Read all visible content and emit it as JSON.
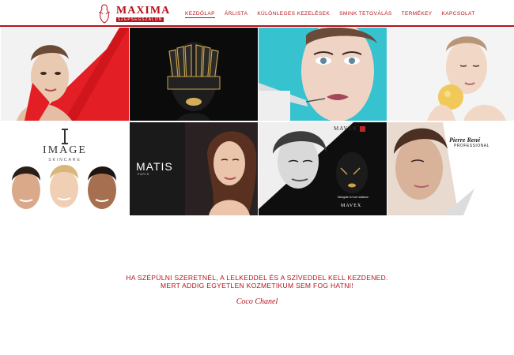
{
  "brand": {
    "name": "MAXIMA",
    "subtitle": "SZÉPSÉGSZALON",
    "accent": "#b5121b"
  },
  "nav": {
    "items": [
      {
        "label": "KEZDŐLAP",
        "active": true
      },
      {
        "label": "ÁRLISTA"
      },
      {
        "label": "KÜLÖNLEGES KEZELÉSEK"
      },
      {
        "label": "SMINK TETOVÁLÁS"
      },
      {
        "label": "TERMÉKEY"
      },
      {
        "label": "KAPCSOLAT"
      }
    ]
  },
  "gallery": {
    "brands": {
      "image": {
        "name": "IMAGE",
        "sub": "SKINCARE"
      },
      "matis": {
        "name": "MATIS",
        "sub": "PARIS"
      },
      "mavex": {
        "name": "MAVEX",
        "tagline": "Navigate to true radiance",
        "name2": "MAVEX"
      },
      "pierre": {
        "name": "Pierre René",
        "sub": "PROFESSIONAL"
      }
    }
  },
  "quote": {
    "line1": "HA SZÉPÜLNI SZERETNÉL, A LELKEDDEL ÉS A SZÍVEDDEL KELL KEZDENED.",
    "line2": "MERT ADDIG EGYETLEN KOZMETIKUM SEM FOG HATNI!",
    "author": "Coco Chanel"
  }
}
